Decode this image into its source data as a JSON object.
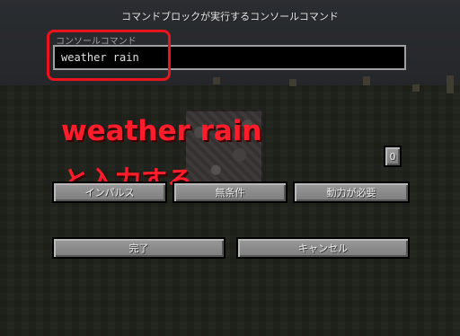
{
  "screen": {
    "title": "コマンドブロックが実行するコンソールコマンド"
  },
  "command_field": {
    "label": "コンソールコマンド",
    "value": "weather rain"
  },
  "annotation": {
    "line1": "weather rain",
    "line2": "と入力する",
    "color": "#ff1d2c"
  },
  "counter": {
    "value": "0"
  },
  "buttons": {
    "mode": "インパルス",
    "condition": "無条件",
    "power": "動力が必要",
    "done": "完了",
    "cancel": "キャンセル"
  }
}
